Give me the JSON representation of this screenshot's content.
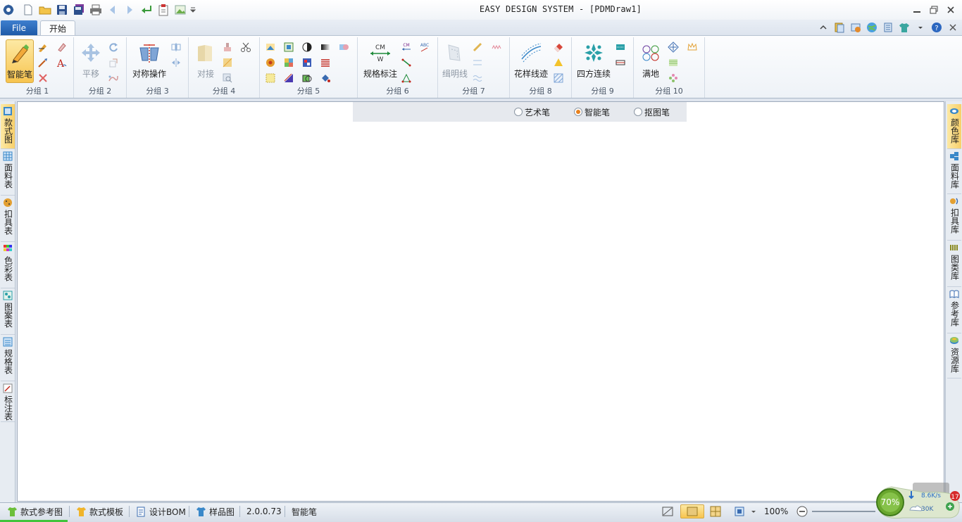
{
  "window": {
    "title": "EASY DESIGN SYSTEM - [PDMDraw1]"
  },
  "quick_access": [
    "new-document-icon",
    "open-folder-icon",
    "save-icon",
    "save-all-icon",
    "print-icon",
    "back-arrow-icon",
    "forward-arrow-icon",
    "return-icon",
    "clipboard-icon",
    "image-icon",
    "dropdown-icon"
  ],
  "tabs": {
    "file": "File",
    "home": "开始"
  },
  "ribbon": {
    "groups": [
      {
        "label": "分组 1",
        "big": "智能笔"
      },
      {
        "label": "分组 2",
        "big": "平移"
      },
      {
        "label": "分组 3",
        "big": "对称操作"
      },
      {
        "label": "分组 4",
        "big": "对接"
      },
      {
        "label": "分组 5"
      },
      {
        "label": "分组 6",
        "big": "规格标注",
        "big_icon_top": "CM",
        "big_icon_bottom": "W",
        "small_text_1": "CM",
        "small_text_2": "ABC"
      },
      {
        "label": "分组 7",
        "big": "缉明线"
      },
      {
        "label": "分组 8",
        "big": "花样线迹"
      },
      {
        "label": "分组 9",
        "big": "四方连续"
      },
      {
        "label": "分组 10",
        "big": "满地"
      }
    ]
  },
  "left_tabs": [
    "款式图",
    "面料表",
    "扣具表",
    "色彩表",
    "图案表",
    "规格表",
    "标注表"
  ],
  "right_tabs": [
    "颜色库",
    "面料库",
    "扣具库",
    "图类库",
    "参考库",
    "资源库"
  ],
  "pen_options": {
    "items": [
      "艺术笔",
      "智能笔",
      "抠图笔"
    ],
    "selected": "智能笔"
  },
  "status": {
    "items": [
      "款式参考图",
      "款式模板",
      "设计BOM",
      "样品图"
    ],
    "version": "2.0.0.73",
    "mode": "智能笔",
    "zoom": "100%"
  },
  "net_widget": {
    "percent": "70%",
    "speed": "8.6K/s",
    "upload": "30K",
    "badge": "17"
  },
  "colors": {
    "accent_file_tab": "#2a67b8",
    "active_highlight": "#f7c44f",
    "radio_selected": "#e8811e"
  }
}
